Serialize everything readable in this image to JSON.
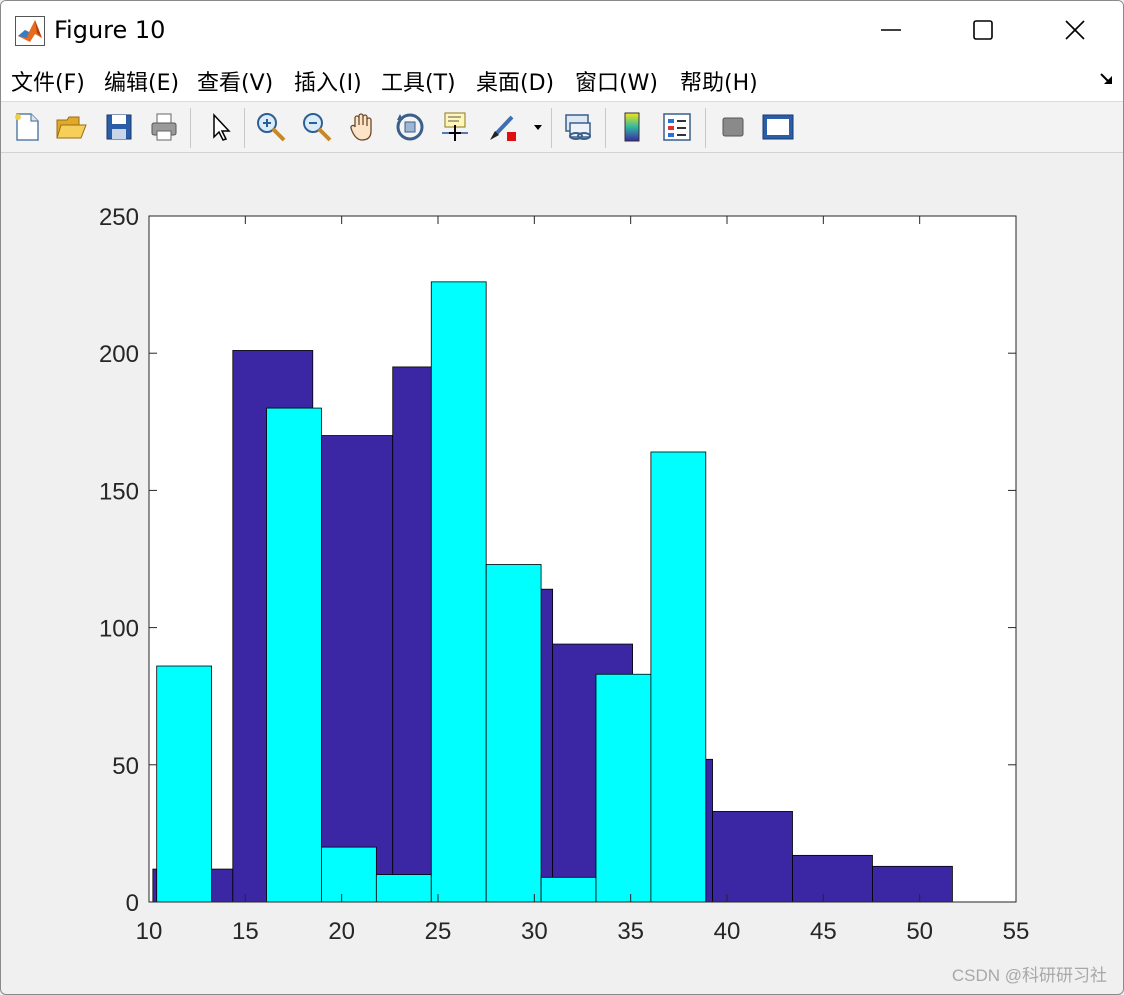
{
  "window": {
    "title": "Figure 10",
    "minimize_icon": "minimize-icon",
    "maximize_icon": "maximize-icon",
    "close_icon": "close-icon"
  },
  "menu": [
    {
      "label": "文件(F)",
      "id": "menu-file"
    },
    {
      "label": "编辑(E)",
      "id": "menu-edit"
    },
    {
      "label": "查看(V)",
      "id": "menu-view"
    },
    {
      "label": "插入(I)",
      "id": "menu-insert"
    },
    {
      "label": "工具(T)",
      "id": "menu-tools"
    },
    {
      "label": "桌面(D)",
      "id": "menu-desktop"
    },
    {
      "label": "窗口(W)",
      "id": "menu-window"
    },
    {
      "label": "帮助(H)",
      "id": "menu-help"
    }
  ],
  "toolbar": [
    "new-figure-icon",
    "open-folder-icon",
    "save-icon",
    "print-icon",
    "pointer-icon",
    "zoom-in-icon",
    "zoom-out-icon",
    "pan-hand-icon",
    "rotate-3d-icon",
    "data-cursor-icon",
    "brush-icon",
    "link-plot-icon",
    "colorbar-icon",
    "legend-icon",
    "hide-plot-tools-icon",
    "show-plot-tools-icon"
  ],
  "colors": {
    "series1": "#3b27a4",
    "series2": "#00ffff",
    "axes_bg": "#ffffff",
    "figure_bg": "#f0f0f0"
  },
  "chart_data": {
    "type": "bar",
    "subtype": "overlaid-histogram",
    "title": "",
    "xlabel": "",
    "ylabel": "",
    "xlim": [
      10,
      55
    ],
    "ylim": [
      0,
      250
    ],
    "xticks": [
      10,
      15,
      20,
      25,
      30,
      35,
      40,
      45,
      50,
      55
    ],
    "yticks": [
      0,
      50,
      100,
      150,
      200,
      250
    ],
    "grid": false,
    "legend": "none",
    "series": [
      {
        "color": "#3b27a4",
        "bins": [
          {
            "x0": 10.2,
            "x1": 14.35,
            "value": 12
          },
          {
            "x0": 14.35,
            "x1": 18.5,
            "value": 201
          },
          {
            "x0": 18.5,
            "x1": 22.65,
            "value": 170
          },
          {
            "x0": 22.65,
            "x1": 26.8,
            "value": 195
          },
          {
            "x0": 26.8,
            "x1": 30.95,
            "value": 114
          },
          {
            "x0": 30.95,
            "x1": 35.1,
            "value": 94
          },
          {
            "x0": 35.1,
            "x1": 39.25,
            "value": 52
          },
          {
            "x0": 39.25,
            "x1": 43.4,
            "value": 33
          },
          {
            "x0": 43.4,
            "x1": 47.55,
            "value": 17
          },
          {
            "x0": 47.55,
            "x1": 51.7,
            "value": 13
          }
        ]
      },
      {
        "color": "#00ffff",
        "bins": [
          {
            "x0": 10.4,
            "x1": 13.25,
            "value": 86
          },
          {
            "x0": 13.25,
            "x1": 16.1,
            "value": 0
          },
          {
            "x0": 16.1,
            "x1": 18.95,
            "value": 180
          },
          {
            "x0": 18.95,
            "x1": 21.8,
            "value": 20
          },
          {
            "x0": 21.8,
            "x1": 24.65,
            "value": 10
          },
          {
            "x0": 24.65,
            "x1": 27.5,
            "value": 226
          },
          {
            "x0": 27.5,
            "x1": 30.35,
            "value": 123
          },
          {
            "x0": 30.35,
            "x1": 33.2,
            "value": 9
          },
          {
            "x0": 33.2,
            "x1": 36.05,
            "value": 83
          },
          {
            "x0": 36.05,
            "x1": 38.9,
            "value": 164
          }
        ]
      }
    ]
  },
  "watermark": "CSDN @科研研习社"
}
